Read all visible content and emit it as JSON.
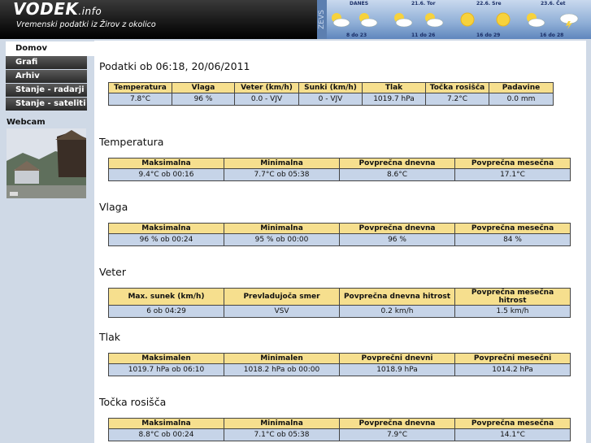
{
  "header": {
    "brand": "VODEK",
    "brand_suffix": ".info",
    "tagline": "Vremenski podatki iz Žirov z okolico",
    "zevs": "ZEVS"
  },
  "forecast": [
    {
      "day": "DANES",
      "temp": "8 do 23",
      "icon": "partly-cloudy-icon"
    },
    {
      "day": "21.6. Tor",
      "temp": "11 do 26",
      "icon": "partly-cloudy-icon"
    },
    {
      "day": "22.6. Sre",
      "temp": "16 do 29",
      "icon": "sunny-icon"
    },
    {
      "day": "23.6. Čet",
      "temp": "16 do 28",
      "icon": "thunderstorm-icon"
    }
  ],
  "nav": [
    "Domov",
    "Grafi",
    "Arhiv",
    "Stanje - radarji",
    "Stanje - sateliti"
  ],
  "webcam": {
    "title": "Webcam"
  },
  "current": {
    "title": "Podatki ob 06:18, 20/06/2011",
    "headers": [
      "Temperatura",
      "Vlaga",
      "Veter (km/h)",
      "Sunki (km/h)",
      "Tlak",
      "Točka rosišča",
      "Padavine"
    ],
    "values": [
      "7.8°C",
      "96 %",
      "0.0 - VJV",
      "0 - VJV",
      "1019.7 hPa",
      "7.2°C",
      "0.0 mm"
    ]
  },
  "sections": [
    {
      "title": "Temperatura",
      "headers": [
        "Maksimalna",
        "Minimalna",
        "Povprečna dnevna",
        "Povprečna mesečna"
      ],
      "values": [
        "9.4°C ob 00:16",
        "7.7°C ob 05:38",
        "8.6°C",
        "17.1°C"
      ]
    },
    {
      "title": "Vlaga",
      "headers": [
        "Maksimalna",
        "Minimalna",
        "Povprečna dnevna",
        "Povprečna mesečna"
      ],
      "values": [
        "96 % ob 00:24",
        "95 % ob 00:00",
        "96 %",
        "84 %"
      ]
    },
    {
      "title": "Veter",
      "headers": [
        "Max. sunek (km/h)",
        "Prevladujoča smer",
        "Povprečna dnevna hitrost",
        "Povprečna mesečna hitrost"
      ],
      "values": [
        "6 ob 04:29",
        "VSV",
        "0.2 km/h",
        "1.5 km/h"
      ]
    },
    {
      "title": "Tlak",
      "headers": [
        "Maksimalen",
        "Minimalen",
        "Povprečni dnevni",
        "Povprečni mesečni"
      ],
      "values": [
        "1019.7 hPa ob 06:10",
        "1018.2 hPa ob 00:00",
        "1018.9 hPa",
        "1014.2 hPa"
      ]
    },
    {
      "title": "Točka rosišča",
      "headers": [
        "Maksimalna",
        "Minimalna",
        "Povprečna dnevna",
        "Povprečna mesečna"
      ],
      "values": [
        "8.8°C ob 00:24",
        "7.1°C ob 05:38",
        "7.9°C",
        "14.1°C"
      ]
    }
  ]
}
